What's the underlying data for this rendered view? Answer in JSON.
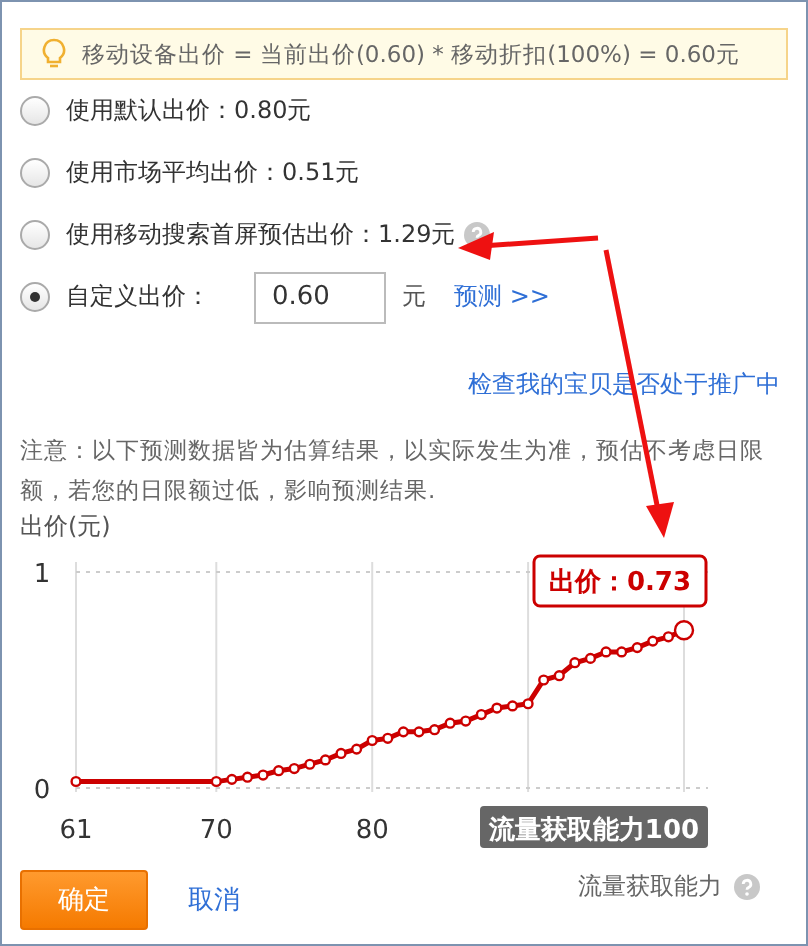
{
  "tip": "移动设备出价 = 当前出价(0.60) * 移动折扣(100%) = 0.60元",
  "options": [
    {
      "kind": "radio",
      "label": "使用默认出价：0.80元",
      "selected": false
    },
    {
      "kind": "radio",
      "label": "使用市场平均出价：0.51元",
      "selected": false
    },
    {
      "kind": "radio-help",
      "label": "使用移动搜索首屏预估出价：1.29元",
      "selected": false
    },
    {
      "kind": "radio-input",
      "label": "自定义出价：",
      "value": "0.60",
      "unit": "元",
      "link": "预测 >>",
      "selected": true
    }
  ],
  "check_link": "检查我的宝贝是否处于推广中",
  "notice": "注意：以下预测数据皆为估算结果，以实际发生为准，预估不考虑日限额，若您的日限额过低，影响预测结果.",
  "chart": {
    "point_label": "出价：0.73",
    "tooltip": "流量获取能力100",
    "axis_caption": "流量获取能力",
    "chart_data": {
      "type": "line",
      "ylabel": "出价(元)",
      "x": [
        61,
        70,
        71,
        72,
        73,
        74,
        75,
        76,
        77,
        78,
        79,
        80,
        81,
        82,
        83,
        84,
        85,
        86,
        87,
        88,
        89,
        90,
        91,
        92,
        93,
        94,
        95,
        96,
        97,
        98,
        99,
        100
      ],
      "series": [
        {
          "marker": true,
          "color": "#cc0000",
          "values": [
            0.03,
            0.03,
            0.04,
            0.05,
            0.06,
            0.08,
            0.09,
            0.11,
            0.13,
            0.16,
            0.18,
            0.22,
            0.23,
            0.26,
            0.26,
            0.27,
            0.3,
            0.31,
            0.34,
            0.37,
            0.38,
            0.39,
            0.5,
            0.52,
            0.58,
            0.6,
            0.63,
            0.63,
            0.65,
            0.68,
            0.7,
            0.73
          ]
        }
      ],
      "xlim": [
        61,
        100
      ],
      "ylim": [
        0,
        1
      ],
      "xticks": [
        61,
        70,
        80
      ],
      "yticks": [
        0,
        1
      ]
    }
  },
  "buttons": {
    "ok": "确定",
    "cancel": "取消"
  }
}
